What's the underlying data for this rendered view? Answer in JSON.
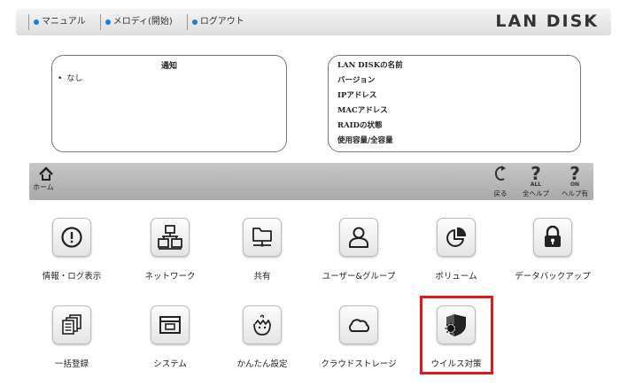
{
  "nav": {
    "links": [
      {
        "label": "マニュアル"
      },
      {
        "label": "メロディ(開始)"
      },
      {
        "label": "ログアウト"
      }
    ],
    "brand": "LAN DISK"
  },
  "notice": {
    "title": "通知",
    "item": "なし"
  },
  "device_info": {
    "rows": [
      "LAN DISKの名前",
      "バージョン",
      "IPアドレス",
      "MACアドレス",
      "RAIDの状態",
      "使用容量/全容量"
    ]
  },
  "toolbar": {
    "home_label": "ホーム",
    "back_label": "戻る",
    "allhelp_sub": "ALL",
    "allhelp_label": "全ヘルプ",
    "helpon_sub": "ON",
    "helpon_label": "ヘルプ有"
  },
  "tiles": [
    {
      "label": "情報・ログ表示",
      "icon": "info-icon"
    },
    {
      "label": "ネットワーク",
      "icon": "network-icon"
    },
    {
      "label": "共有",
      "icon": "shared-folder-icon"
    },
    {
      "label": "ユーザー&グループ",
      "icon": "user-icon"
    },
    {
      "label": "ボリューム",
      "icon": "volume-pie-icon"
    },
    {
      "label": "データバックアップ",
      "icon": "lock-icon"
    },
    {
      "label": "一括登録",
      "icon": "bulk-register-icon"
    },
    {
      "label": "システム",
      "icon": "system-window-icon"
    },
    {
      "label": "かんたん設定",
      "icon": "easy-setup-icon"
    },
    {
      "label": "クラウドストレージ",
      "icon": "cloud-icon"
    },
    {
      "label": "ウイルス対策",
      "icon": "antivirus-shield-icon"
    }
  ],
  "colors": {
    "nav_dot": "#1b7ed6",
    "highlight": "#e01a1a",
    "toolbar": "#b8b8b8"
  }
}
